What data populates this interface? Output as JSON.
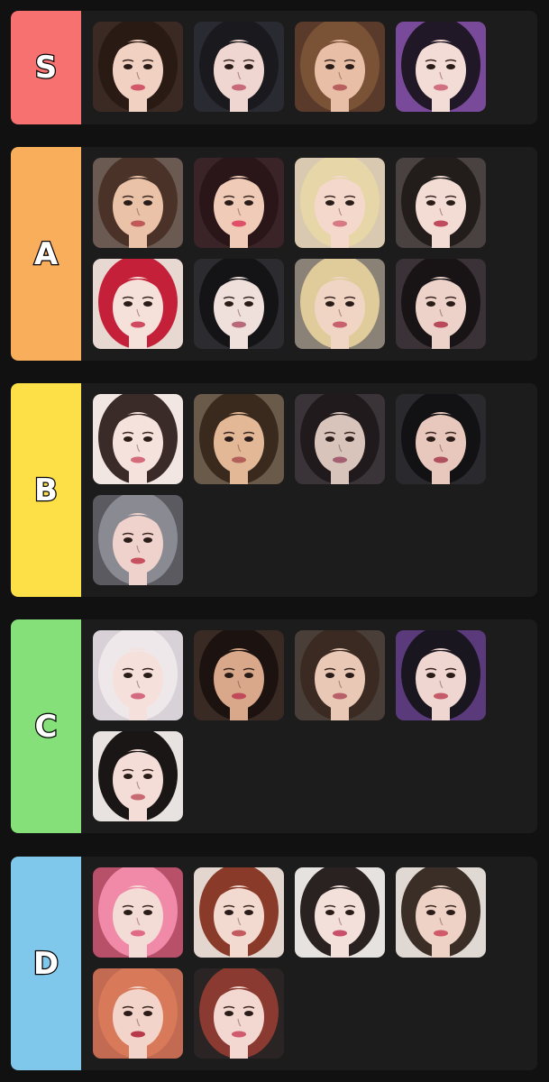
{
  "tiers": [
    {
      "id": "s",
      "label": "S",
      "color": "#f87171",
      "items": [
        {
          "bg": "#3b2a24",
          "hair": "#2a1a14",
          "skin": "#f1d2c2",
          "lips": "#d2586a"
        },
        {
          "bg": "#2a2a32",
          "hair": "#1a1a1e",
          "skin": "#efd6d0",
          "lips": "#c96a7a"
        },
        {
          "bg": "#5a3a2a",
          "hair": "#7a5236",
          "skin": "#e8bfa6",
          "lips": "#b86060"
        },
        {
          "bg": "#7a4a9a",
          "hair": "#201826",
          "skin": "#f3dcd6",
          "lips": "#d07080"
        }
      ]
    },
    {
      "id": "a",
      "label": "A",
      "color": "#f9ae5c",
      "items": [
        {
          "bg": "#6a5a52",
          "hair": "#4a3228",
          "skin": "#e9c2a8",
          "lips": "#c05a5a"
        },
        {
          "bg": "#3a2428",
          "hair": "#2a1618",
          "skin": "#f0cbb8",
          "lips": "#e0506a"
        },
        {
          "bg": "#d8c9b0",
          "hair": "#e6d6a8",
          "skin": "#f4d8cc",
          "lips": "#d87a86"
        },
        {
          "bg": "#4a4240",
          "hair": "#221c1a",
          "skin": "#f2dcd4",
          "lips": "#c24a5e"
        },
        {
          "bg": "#e8d8d2",
          "hair": "#c4203a",
          "skin": "#f6e0da",
          "lips": "#d04a60"
        },
        {
          "bg": "#2c2c30",
          "hair": "#141416",
          "skin": "#efe0dc",
          "lips": "#b86a78"
        },
        {
          "bg": "#8a8276",
          "hair": "#e0cc9a",
          "skin": "#f0d4c4",
          "lips": "#c86070"
        },
        {
          "bg": "#3a3236",
          "hair": "#181416",
          "skin": "#ecd2c8",
          "lips": "#b84a5a"
        }
      ]
    },
    {
      "id": "b",
      "label": "B",
      "color": "#fde047",
      "items": [
        {
          "bg": "#f2e6e2",
          "hair": "#3a2a28",
          "skin": "#f6e2dc",
          "lips": "#d46a7a"
        },
        {
          "bg": "#6a5a4a",
          "hair": "#3a2a1e",
          "skin": "#e2b896",
          "lips": "#b4605a"
        },
        {
          "bg": "#3a3438",
          "hair": "#201a1c",
          "skin": "#d9c4bc",
          "lips": "#a46070"
        },
        {
          "bg": "#2a2a2e",
          "hair": "#121214",
          "skin": "#e8c8bc",
          "lips": "#b0505e"
        },
        {
          "bg": "#5a5a60",
          "hair": "#8a8a92",
          "skin": "#f0d2cc",
          "lips": "#c8505e"
        }
      ]
    },
    {
      "id": "c",
      "label": "C",
      "color": "#86e07a",
      "items": [
        {
          "bg": "#d8d2d8",
          "hair": "#efe8ea",
          "skin": "#f6e0dc",
          "lips": "#d46a80"
        },
        {
          "bg": "#3a2a24",
          "hair": "#1c1210",
          "skin": "#d9a88a",
          "lips": "#c04a5a"
        },
        {
          "bg": "#4a3e38",
          "hair": "#3a2a22",
          "skin": "#eac8b6",
          "lips": "#b8606a"
        },
        {
          "bg": "#5a3a7a",
          "hair": "#1a1620",
          "skin": "#f0d6d0",
          "lips": "#c45a6a"
        },
        {
          "bg": "#e8e2e0",
          "hair": "#1a1616",
          "skin": "#f4ddd6",
          "lips": "#c86a74"
        }
      ]
    },
    {
      "id": "d",
      "label": "D",
      "color": "#7fc8ec",
      "items": [
        {
          "bg": "#b8506a",
          "hair": "#f08aa8",
          "skin": "#f4dcd6",
          "lips": "#e06a86"
        },
        {
          "bg": "#e2d6ce",
          "hair": "#8a3a28",
          "skin": "#f2dad0",
          "lips": "#c25a60"
        },
        {
          "bg": "#e6e2e0",
          "hair": "#2a2220",
          "skin": "#f4e0da",
          "lips": "#c8506a"
        },
        {
          "bg": "#e0d8d2",
          "hair": "#3a2e26",
          "skin": "#eed2c6",
          "lips": "#d05a6a"
        },
        {
          "bg": "#c26a52",
          "hair": "#d87a5a",
          "skin": "#f2d4ca",
          "lips": "#b83a4a"
        },
        {
          "bg": "#2a2424",
          "hair": "#8a3a30",
          "skin": "#f2d8d0",
          "lips": "#d05a6e"
        }
      ]
    }
  ]
}
